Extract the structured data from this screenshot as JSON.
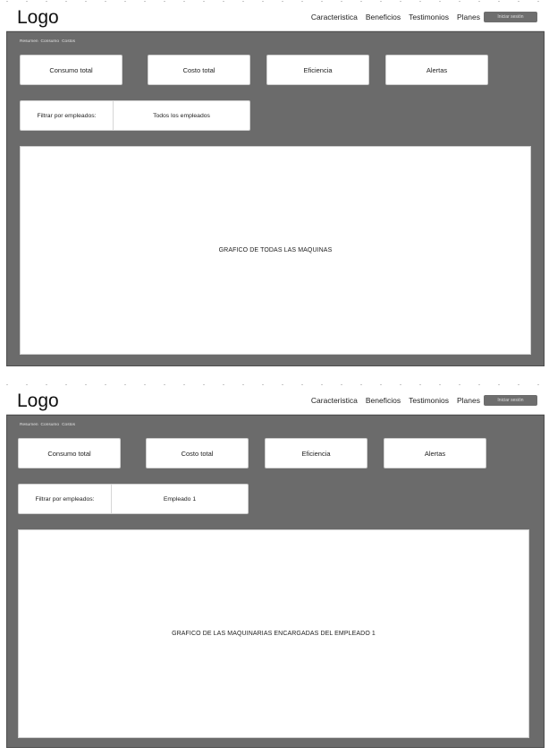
{
  "screens": [
    {
      "logo": "Logo",
      "nav": [
        "Caracteristica",
        "Beneficios",
        "Testimonios",
        "Planes"
      ],
      "login_button": "Iniciar sesión",
      "breadcrumb": [
        "Resumen",
        "Consumo",
        "Costos"
      ],
      "cards": [
        "Consumo total",
        "Costo total",
        "Eficiencia",
        "Alertas"
      ],
      "filter_label": "Filtrar por empleados:",
      "filter_value": "Todos los empleados",
      "chart_placeholder": "GRAFICO DE TODAS LAS MAQUINAS"
    },
    {
      "logo": "Logo",
      "nav": [
        "Caracteristica",
        "Beneficios",
        "Testimonios",
        "Planes"
      ],
      "login_button": "Iniciar sesión",
      "breadcrumb": [
        "Resumen",
        "Consumo",
        "Costos"
      ],
      "cards": [
        "Consumo total",
        "Costo total",
        "Eficiencia",
        "Alertas"
      ],
      "filter_label": "Filtrar por empleados:",
      "filter_value": "Empleado 1",
      "chart_placeholder": "GRAFICO DE LAS MAQUINARIAS ENCARGADAS DEL EMPLEADO 1"
    }
  ],
  "colors": {
    "panel_background": "#6b6b6b",
    "card_background": "#ffffff",
    "login_button": "#6e6e6e"
  }
}
